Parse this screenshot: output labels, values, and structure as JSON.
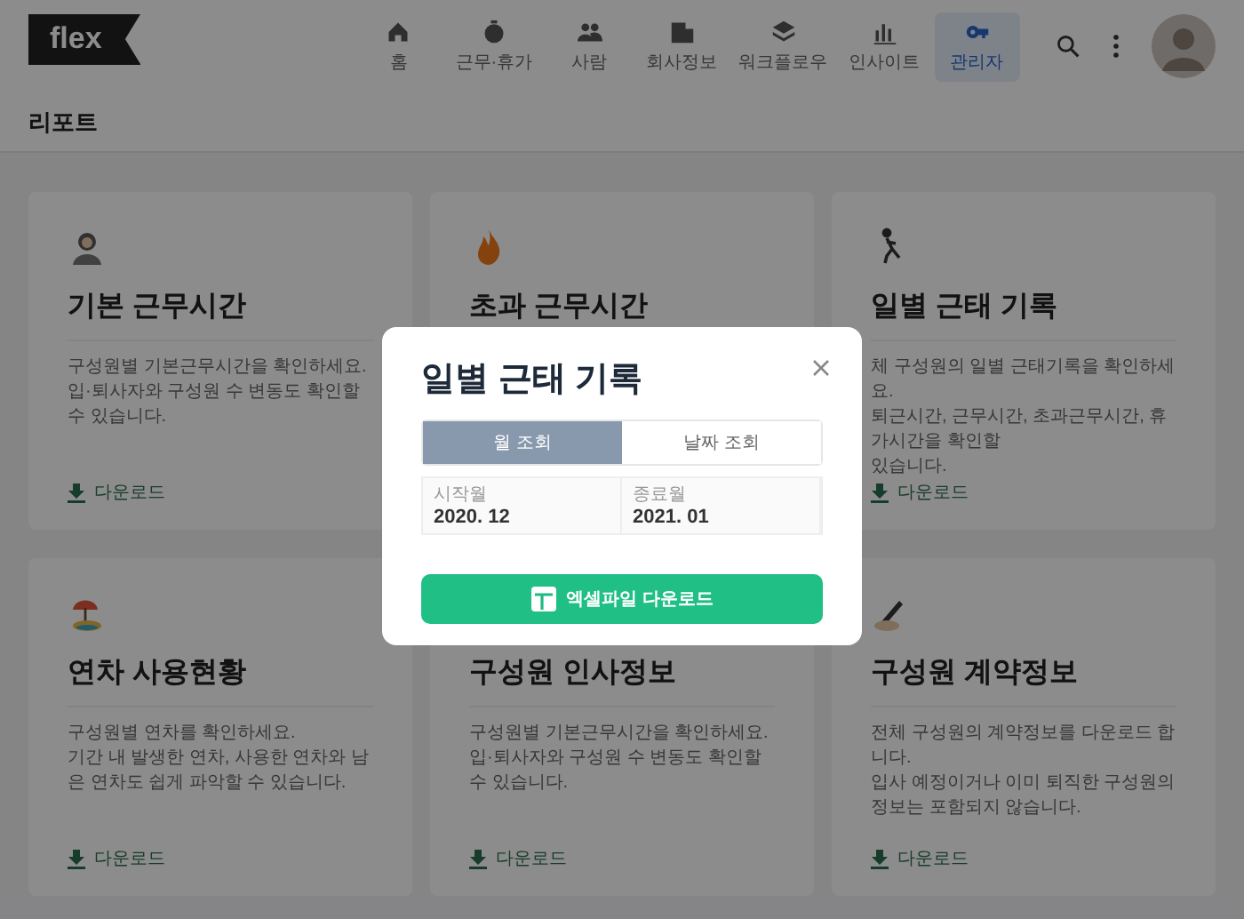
{
  "header": {
    "logo": "flex",
    "nav": [
      {
        "label": "홈",
        "selected": false
      },
      {
        "label": "근무·휴가",
        "selected": false
      },
      {
        "label": "사람",
        "selected": false
      },
      {
        "label": "회사정보",
        "selected": false
      },
      {
        "label": "워크플로우",
        "selected": false
      },
      {
        "label": "인사이트",
        "selected": false
      },
      {
        "label": "관리자",
        "selected": true
      }
    ]
  },
  "page_title": "리포트",
  "cards": [
    {
      "title": "기본 근무시간",
      "description": [
        "구성원별 기본근무시간을 확인하세요.",
        "입·퇴사자와 구성원 수 변동도 확인할 수 있습니다."
      ],
      "download": "다운로드"
    },
    {
      "title": "초과 근무시간"
    },
    {
      "title": "일별 근태 기록",
      "description": [
        "체 구성원의 일별 근태기록을 확인하세요.",
        "퇴근시간, 근무시간, 초과근무시간, 휴가시간을 확인할",
        "있습니다."
      ],
      "download": "다운로드"
    },
    {
      "title": "연차 사용현황",
      "description": [
        "구성원별 연차를 확인하세요.",
        "기간 내 발생한 연차, 사용한 연차와 남은 연차도 쉽게 파악할 수 있습니다."
      ],
      "download": "다운로드"
    },
    {
      "title": "구성원 인사정보",
      "description": [
        "구성원별 기본근무시간을 확인하세요.",
        "입·퇴사자와 구성원 수 변동도 확인할 수 있습니다."
      ],
      "download": "다운로드"
    },
    {
      "title": "구성원 계약정보",
      "description": [
        "전체 구성원의 계약정보를 다운로드 합니다.",
        "입사 예정이거나 이미 퇴직한 구성원의 정보는 포함되지 않습니다."
      ],
      "download": "다운로드"
    }
  ],
  "modal": {
    "title": "일별 근태 기록",
    "tabs": [
      {
        "label": "월 조회",
        "selected": true
      },
      {
        "label": "날짜 조회",
        "selected": false
      }
    ],
    "fields": [
      {
        "label": "시작월",
        "value": "2020. 12"
      },
      {
        "label": "종료월",
        "value": "2021. 01"
      }
    ],
    "button": "엑셀파일 다운로드"
  }
}
